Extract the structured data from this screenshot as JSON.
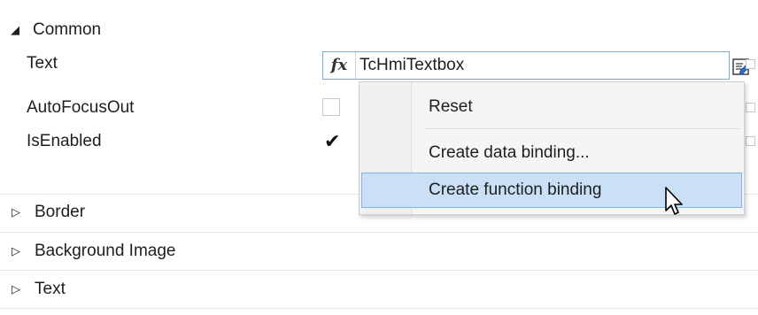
{
  "sections": {
    "common": {
      "label": "Common",
      "expanded": true
    },
    "border": {
      "label": "Border",
      "expanded": false
    },
    "background_image": {
      "label": "Background Image",
      "expanded": false
    },
    "text": {
      "label": "Text",
      "expanded": false
    }
  },
  "properties": {
    "text": {
      "label": "Text",
      "fx_symbol": "fx",
      "value": "TcHmiTextbox"
    },
    "auto_focus_out": {
      "label": "AutoFocusOut",
      "checked": false
    },
    "is_enabled": {
      "label": "IsEnabled",
      "checked": true
    }
  },
  "context_menu": {
    "items": [
      {
        "label": "Reset"
      },
      {
        "label": "Create data binding..."
      },
      {
        "label": "Create function binding",
        "hovered": true
      }
    ]
  },
  "glyphs": {
    "expanded": "◢",
    "collapsed": "▷",
    "checkmark": "✔"
  },
  "icons": {
    "edit": "edit-icon",
    "cursor": "arrow-cursor-icon"
  },
  "colors": {
    "menu_hover_bg": "#c9e0f7",
    "menu_hover_border": "#7eb4ea",
    "field_border": "#7aa7d6"
  }
}
